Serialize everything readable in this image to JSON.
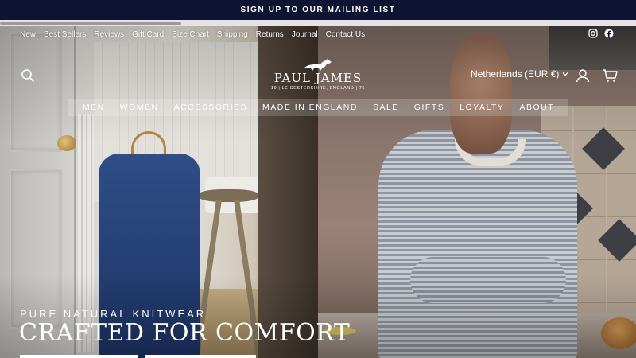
{
  "announcement": {
    "text": "SIGN UP TO OUR MAILING LIST"
  },
  "utility_nav": [
    "New",
    "Best Sellers",
    "Reviews",
    "Gift Card",
    "Size Chart",
    "Shipping",
    "Returns",
    "Journal",
    "Contact Us"
  ],
  "social": {
    "instagram_icon": "instagram-icon",
    "facebook_icon": "facebook-icon"
  },
  "header": {
    "brand_name": "PAUL JAMES",
    "brand_tagline": "19 | LEICESTERSHIRE, ENGLAND | 76",
    "currency": "Netherlands (EUR €)"
  },
  "main_nav": [
    "MEN",
    "WOMEN",
    "ACCESSORIES",
    "MADE IN ENGLAND",
    "SALE",
    "GIFTS",
    "LOYALTY",
    "ABOUT"
  ],
  "hero": {
    "subtitle": "PURE NATURAL KNITWEAR",
    "title": "CRAFTED FOR COMFORT"
  },
  "colors": {
    "announcement_bg": "#0f1433",
    "text": "#ffffff"
  }
}
